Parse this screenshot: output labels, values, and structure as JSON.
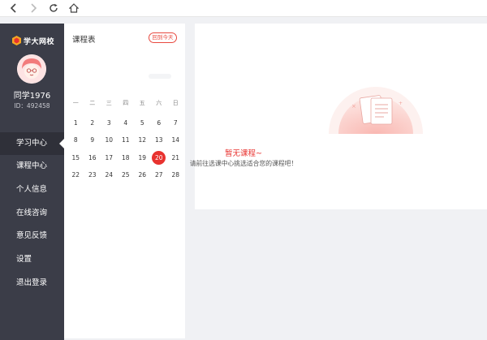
{
  "browser": {
    "back_icon": "chevron-left-icon",
    "forward_icon": "chevron-right-icon",
    "reload_icon": "reload-icon",
    "home_icon": "home-icon"
  },
  "sidebar": {
    "logo_text": "学大网校",
    "username": "同学1976",
    "user_id": "ID：492458",
    "items": [
      {
        "label": "学习中心",
        "active": true
      },
      {
        "label": "课程中心",
        "active": false
      },
      {
        "label": "个人信息",
        "active": false
      },
      {
        "label": "在线咨询",
        "active": false
      },
      {
        "label": "意见反馈",
        "active": false
      },
      {
        "label": "设置",
        "active": false
      },
      {
        "label": "退出登录",
        "active": false
      }
    ]
  },
  "calendar": {
    "title": "课程表",
    "today_button": "回到今天",
    "weekdays": [
      "一",
      "二",
      "三",
      "四",
      "五",
      "六",
      "日"
    ],
    "days": [
      "1",
      "2",
      "3",
      "4",
      "5",
      "6",
      "7",
      "8",
      "9",
      "10",
      "11",
      "12",
      "13",
      "14",
      "15",
      "16",
      "17",
      "18",
      "19",
      "20",
      "21",
      "22",
      "23",
      "24",
      "25",
      "26",
      "27",
      "28"
    ],
    "today": "20"
  },
  "main": {
    "empty_title": "暂无课程~",
    "empty_subtitle": "请前往选课中心挑选适合您的课程吧！"
  },
  "colors": {
    "sidebar_bg": "#3b3d48",
    "accent_red": "#e8322f",
    "page_bg": "#f0f1f4"
  }
}
